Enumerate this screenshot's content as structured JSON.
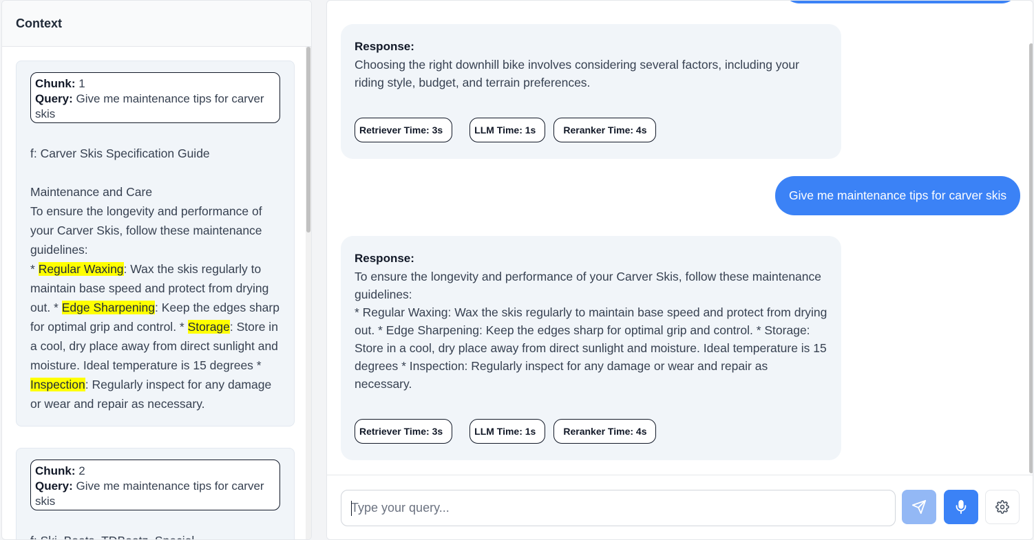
{
  "context": {
    "title": "Context",
    "chunks": [
      {
        "chunk_label": "Chunk:",
        "chunk_value": "1",
        "query_label": "Query:",
        "query_value": "Give me maintenance tips for carver skis",
        "source": "f: Carver Skis Specification Guide",
        "section": "Maintenance and Care",
        "intro": "To ensure the longevity and performance of your Carver Skis, follow these maintenance guidelines:",
        "bullet_prefix": "* ",
        "items": [
          {
            "term": "Regular Waxing",
            "desc": ": Wax the skis regularly to maintain base speed and protect from drying out. * "
          },
          {
            "term": "Edge Sharpening",
            "desc": ": Keep the edges sharp for optimal grip and control. * "
          },
          {
            "term": "Storage",
            "desc": ": Store in a cool, dry place away from direct sunlight and moisture. Ideal temperature is 15 degrees * "
          },
          {
            "term": "Inspection",
            "desc": ": Regularly inspect for any damage or wear and repair as necessary."
          }
        ]
      },
      {
        "chunk_label": "Chunk:",
        "chunk_value": "2",
        "query_label": "Query:",
        "query_value": "Give me maintenance tips for carver skis",
        "source": "f: Ski_Boots_TDBootz_Special"
      }
    ]
  },
  "chat": {
    "messages": [
      {
        "label": "Response:",
        "text": "Choosing the right downhill bike involves considering several factors, including your riding style, budget, and terrain preferences.",
        "retriever_time": "Retriever Time: 3s",
        "llm_time": "LLM Time: 1s",
        "reranker_time": "Reranker Time: 4s"
      },
      {
        "user_text": "Give me maintenance tips for carver skis"
      },
      {
        "label": "Response:",
        "text": "To ensure the longevity and performance of your Carver Skis, follow these maintenance guidelines:\n* Regular Waxing: Wax the skis regularly to maintain base speed and protect from drying out. * Edge Sharpening: Keep the edges sharp for optimal grip and control. * Storage: Store in a cool, dry place away from direct sunlight and moisture. Ideal temperature is 15 degrees * Inspection: Regularly inspect for any damage or wear and repair as necessary.",
        "retriever_time": "Retriever Time: 3s",
        "llm_time": "LLM Time: 1s",
        "reranker_time": "Reranker Time: 4s"
      }
    ],
    "input": {
      "value": "",
      "placeholder": "Type your query..."
    },
    "icons": {
      "send": "send-icon",
      "mic": "microphone-icon",
      "settings": "gear-icon"
    }
  },
  "colors": {
    "accent": "#3b82f6",
    "send_disabled": "#93b8f5",
    "highlight": "#ffff00",
    "bubble_bg": "#f1f5f9"
  }
}
